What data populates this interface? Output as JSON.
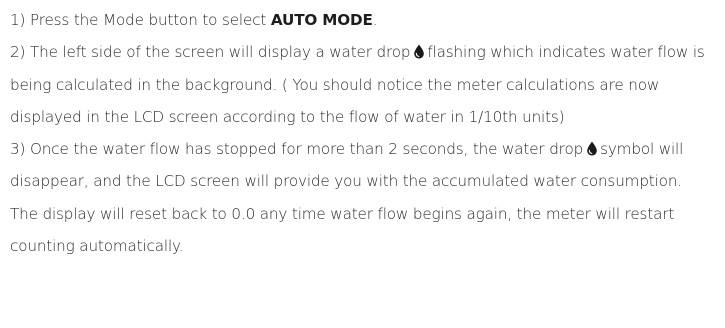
{
  "steps": [
    {
      "prefix": "1) Press the Mode button to select ",
      "emphasis": "AUTO MODE",
      "suffix": "."
    },
    {
      "before_icon": "2) The left side of the screen will display a water drop",
      "icon": "water-drop-icon",
      "after_icon": "flashing which indicates water flow is being calculated in the background. ( You should notice the meter calculations are now displayed in the LCD screen according to the flow of water in 1/10th units)"
    },
    {
      "before_icon": "3) Once the water flow has stopped for more than 2 seconds, the water drop",
      "icon": "water-drop-icon",
      "after_icon": "symbol will disappear, and the LCD screen will provide you with the accumulated water consumption. The display will reset back to 0.0 any time water flow begins again, the meter will restart counting automatically."
    }
  ],
  "colors": {
    "text": "#2b2b2b",
    "icon": "#1a1a1a"
  }
}
